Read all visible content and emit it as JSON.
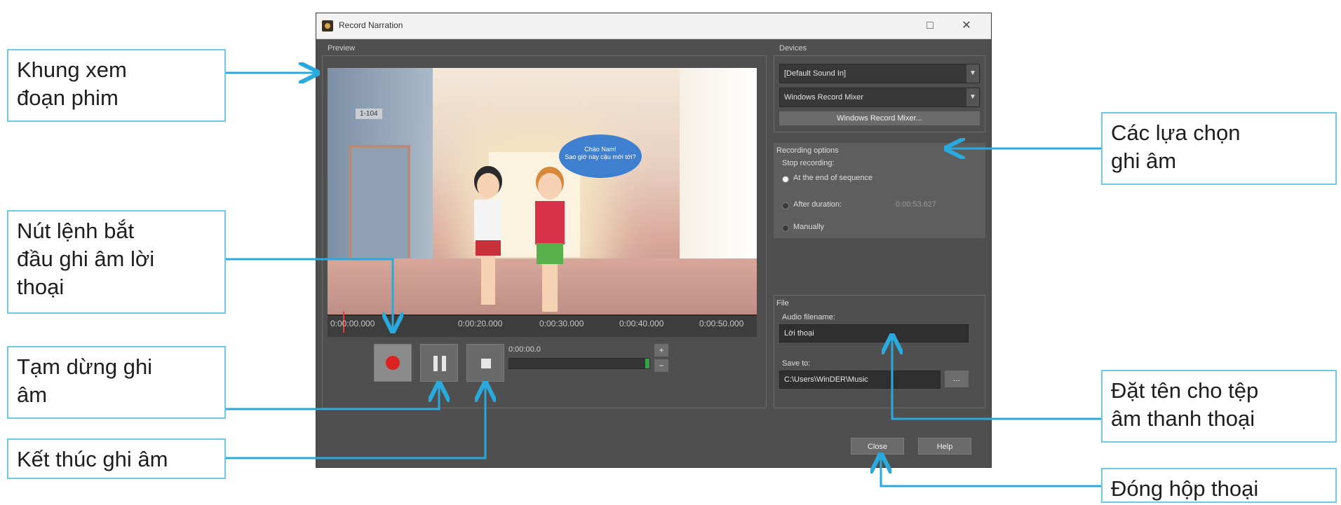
{
  "window": {
    "title": "Record Narration",
    "restore_symbol": "□",
    "close_symbol": "✕"
  },
  "preview": {
    "label": "Preview",
    "room_tag": "1-104",
    "speech_bubble": "Chào Nam!\nSao giờ này cậu mới tới?"
  },
  "timeline": {
    "ticks": [
      "0:00:00.000",
      "0:00:20.000",
      "0:00:30.000",
      "0:00:40.000",
      "0:00:50.000"
    ]
  },
  "recording": {
    "time": "0:00:00.0",
    "level_fraction": 0.03
  },
  "devices": {
    "label": "Devices",
    "input": "[Default Sound In]",
    "source": "Windows Record Mixer",
    "mixer_button": "Windows Record Mixer..."
  },
  "recording_options": {
    "label": "Recording options",
    "stop_label": "Stop recording:",
    "opt_end": "At the end of sequence",
    "opt_duration": "After duration:",
    "duration_value": "0:00:53.627",
    "opt_manual": "Manually"
  },
  "file": {
    "label": "File",
    "filename_label": "Audio filename:",
    "filename": "Lời thoại",
    "save_label": "Save to:",
    "save_path": "C:\\Users\\WinDER\\Music",
    "browse": "..."
  },
  "buttons": {
    "close": "Close",
    "help": "Help"
  },
  "callouts": {
    "preview_frame": "Khung xem\nđoạn phim",
    "start_record": "Nút lệnh bắt\nđầu ghi âm lời\nthoại",
    "pause_record": "Tạm dừng ghi\nâm",
    "stop_record": "Kết thúc ghi âm",
    "rec_options": "Các lựa chọn\nghi âm",
    "name_file": "Đặt tên cho tệp\nâm thanh thoại",
    "close_dialog": "Đóng hộp thoại"
  },
  "colors": {
    "callout_border": "#6ec9e6",
    "arrow": "#29a9dc",
    "record_red": "#dd2222",
    "level_green": "#38a148"
  }
}
